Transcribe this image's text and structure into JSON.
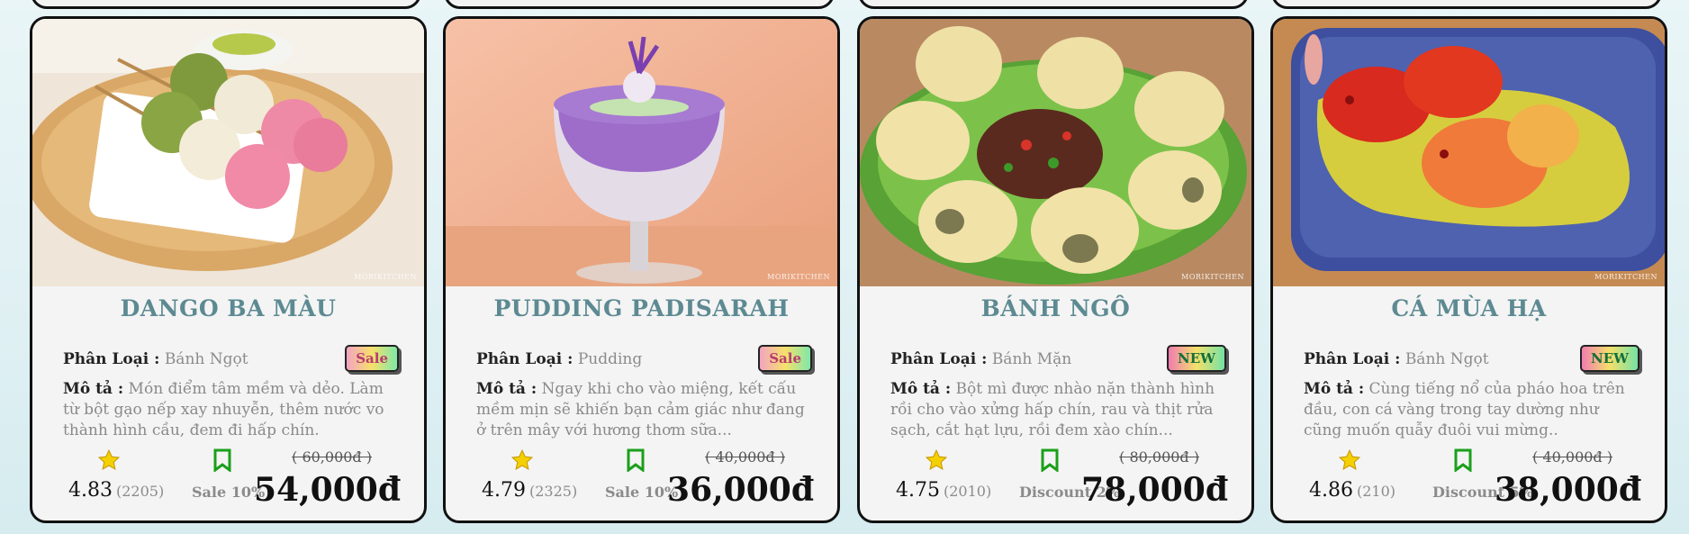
{
  "cards": [
    {
      "title": "DANGO BA MÀU",
      "category_label": "Phân Loại :",
      "category": "Bánh Ngọt",
      "badge": "Sale",
      "desc_label": "Mô tả :",
      "description": "Món điểm tâm mềm và dẻo. Làm từ bột gạo nếp xay nhuyễn, thêm nước vo thành hình cầu, đem đi hấp chín.",
      "rating": "4.83",
      "rating_count": "(2205)",
      "discount": "Sale 10%",
      "old_price": "( 60,000đ )",
      "price": "54,000đ",
      "watermark": "MORIKITCHEN"
    },
    {
      "title": "PUDDING PADISARAH",
      "category_label": "Phân Loại :",
      "category": "Pudding",
      "badge": "Sale",
      "desc_label": "Mô tả :",
      "description": "Ngay khi cho vào miệng, kết cấu mềm mịn sẽ khiến bạn cảm giác như đang ở trên mây với hương thơm sữa...",
      "rating": "4.79",
      "rating_count": "(2325)",
      "discount": "Sale 10%",
      "old_price": "( 40,000đ )",
      "price": "36,000đ",
      "watermark": "MORIKITCHEN"
    },
    {
      "title": "BÁNH NGÔ",
      "category_label": "Phân Loại :",
      "category": "Bánh Mặn",
      "badge": "NEW",
      "desc_label": "Mô tả :",
      "description": "Bột mì được nhào nặn thành hình rồi cho vào xửng hấp chín, rau và thịt rửa sạch, cắt hạt lựu, rồi đem xào chín...",
      "rating": "4.75",
      "rating_count": "(2010)",
      "discount": "Discount 2%",
      "old_price": "( 80,000đ )",
      "price": "78,000đ",
      "watermark": "MORIKITCHEN"
    },
    {
      "title": "CÁ MÙA HẠ",
      "category_label": "Phân Loại :",
      "category": "Bánh Ngọt",
      "badge": "NEW",
      "desc_label": "Mô tả :",
      "description": "Cùng tiếng nổ của pháo hoa trên đầu, con cá vàng trong tay dường như cũng muốn quẫy đuôi vui mừng..",
      "rating": "4.86",
      "rating_count": "(210)",
      "discount": "Discount 5%",
      "old_price": "( 40,000đ )",
      "price": "38,000đ",
      "watermark": "MORIKITCHEN"
    }
  ],
  "icons": {
    "rating": "star-icon",
    "save": "bookmark-icon"
  },
  "colors": {
    "title": "#5d8a92",
    "star": "#f5d000",
    "bookmark": "#1aa01a"
  }
}
